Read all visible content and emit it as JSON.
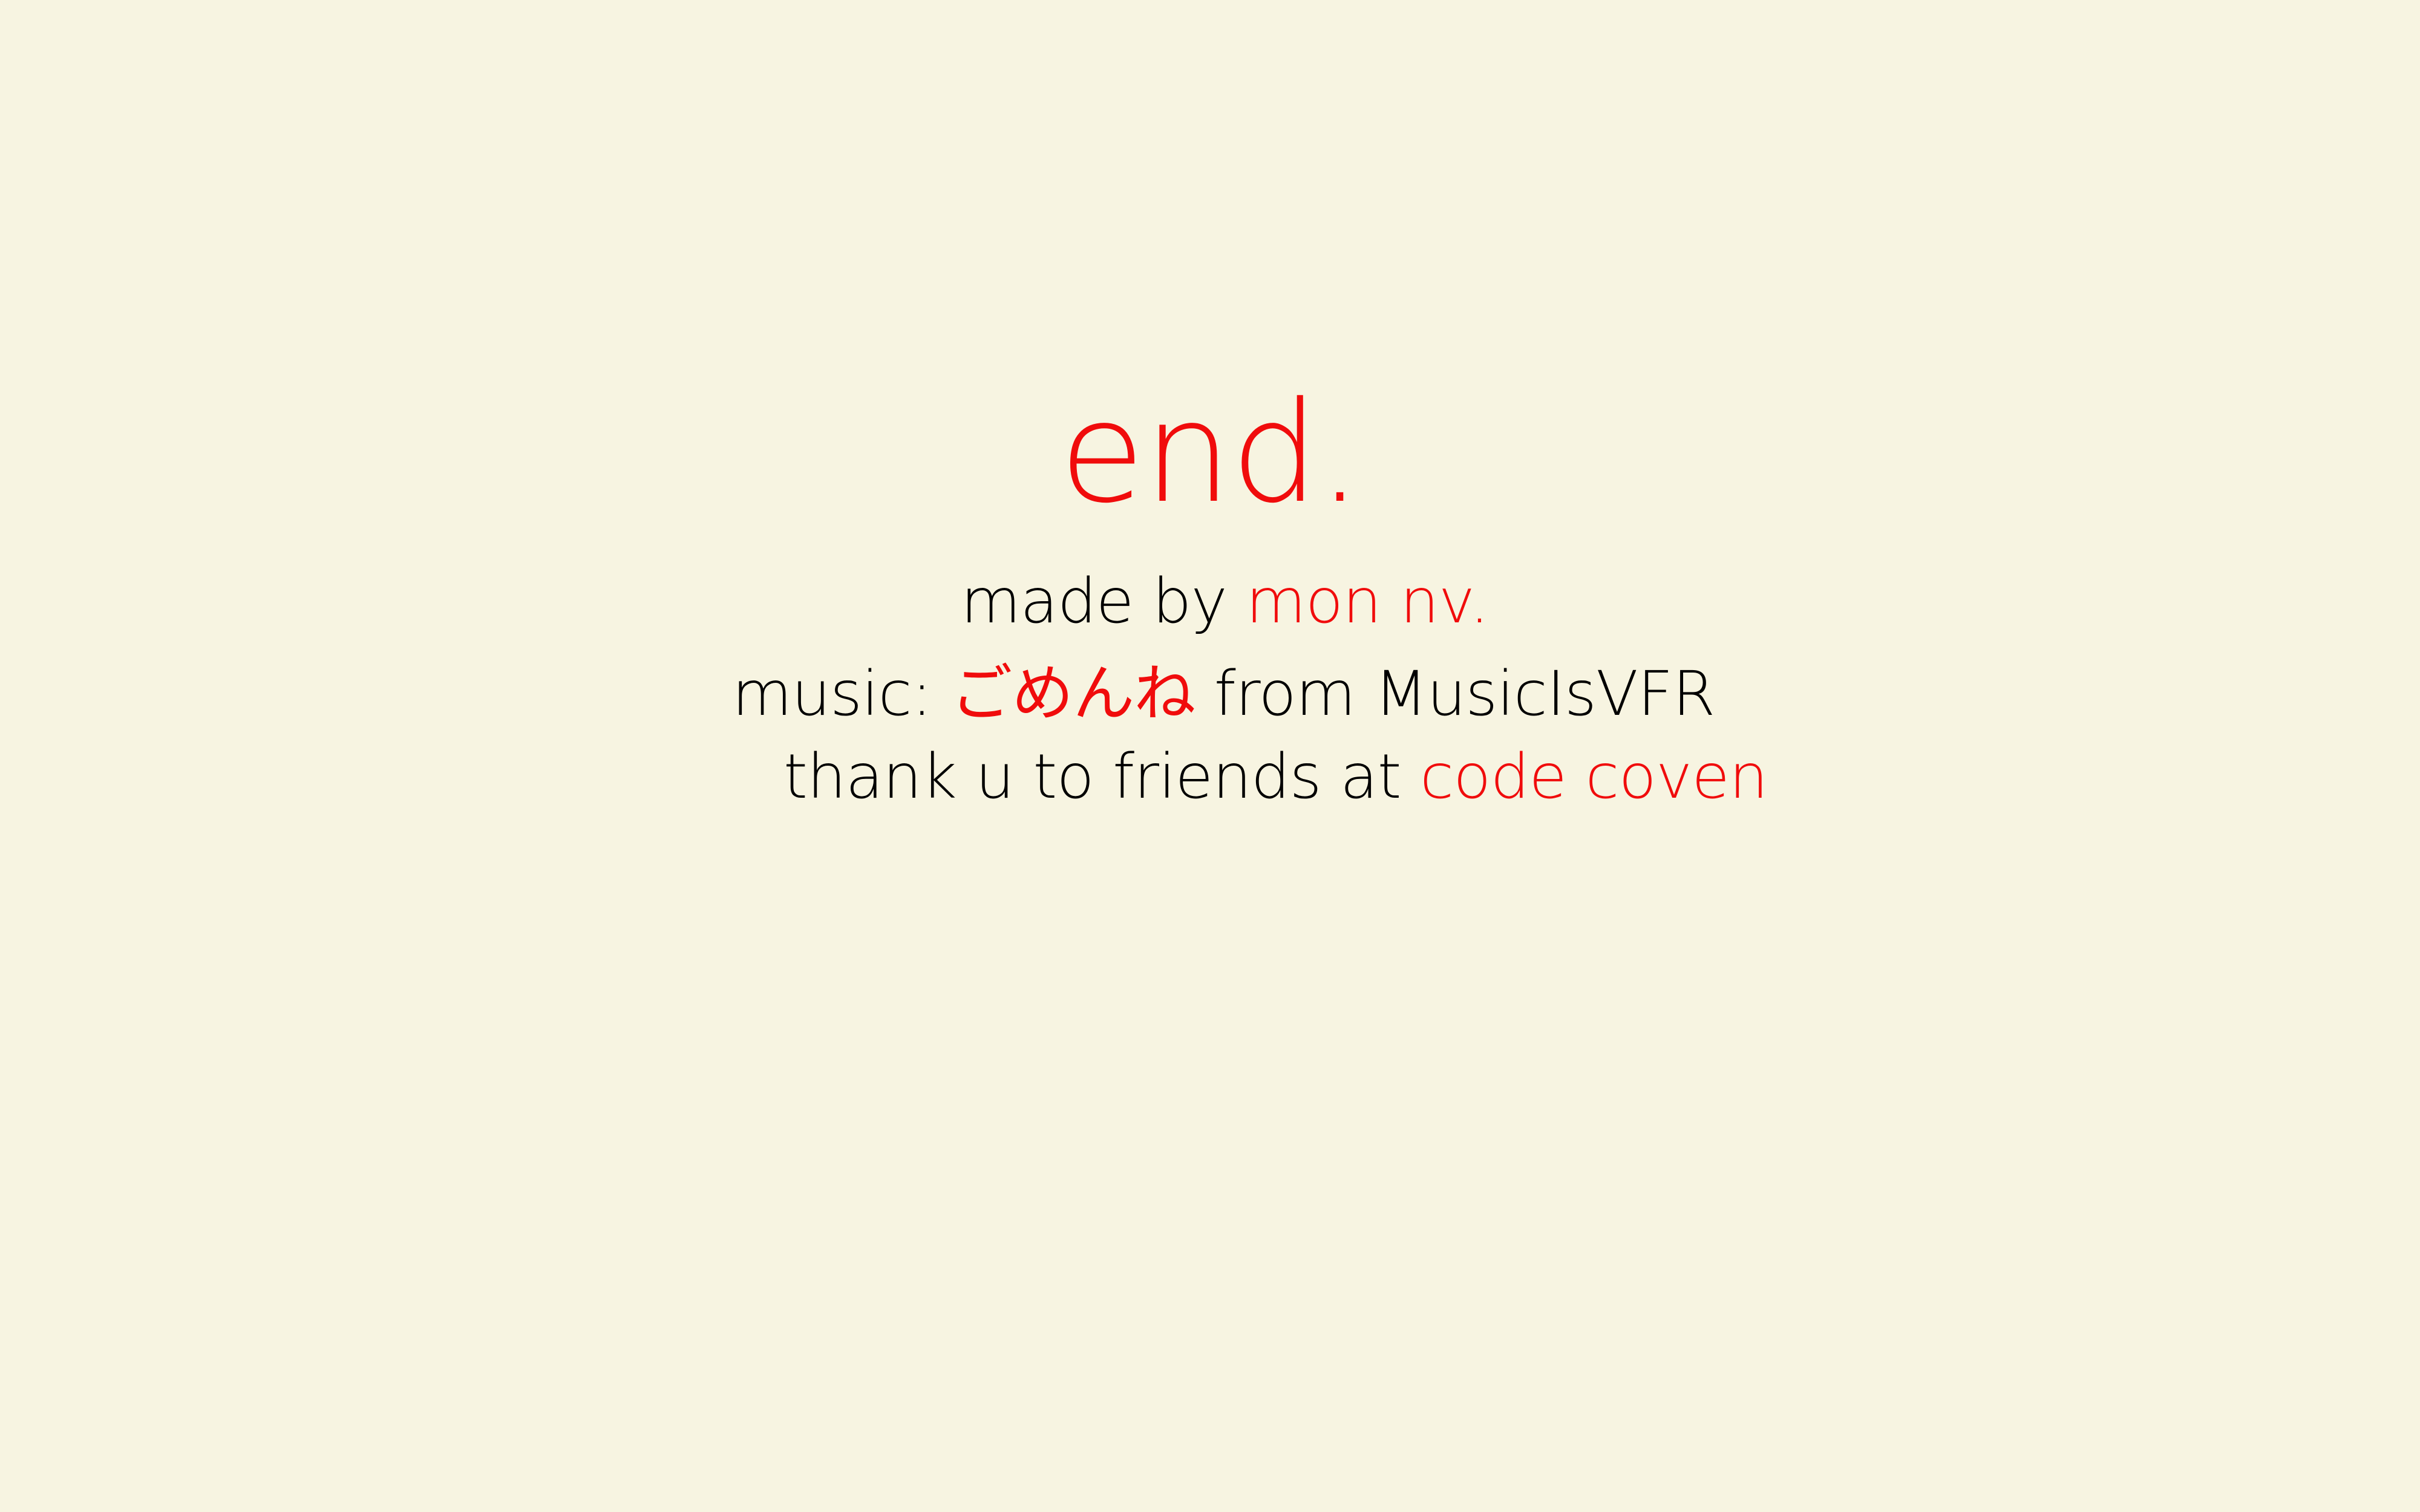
{
  "colors": {
    "background": "#f7f4e1",
    "text": "#000000",
    "accent": "#f00c0c"
  },
  "title": "end.",
  "credits": {
    "made_by": {
      "prefix": "made by ",
      "author": "mon nv."
    },
    "music": {
      "prefix": "music: ",
      "song": "ごめんね",
      "suffix": " from MusicIsVFR"
    },
    "thanks": {
      "prefix": "thank u to friends at ",
      "group": "code coven"
    }
  }
}
